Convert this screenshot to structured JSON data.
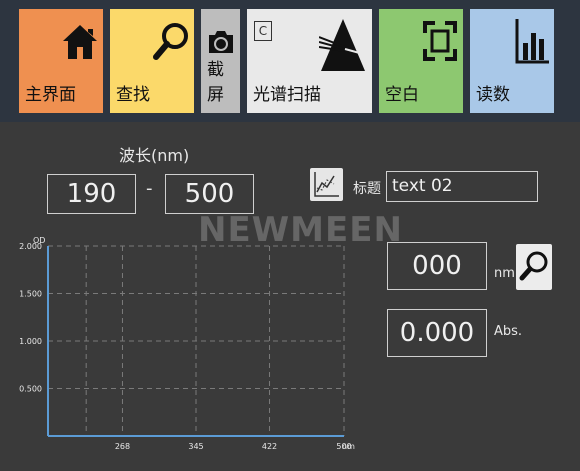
{
  "toolbar": {
    "home": {
      "label": "主界面",
      "icon": "home-icon",
      "color": "#ef9050"
    },
    "find": {
      "label": "查找",
      "icon": "magnifier-icon",
      "color": "#fbd96a"
    },
    "screenshot": {
      "label": "截屏",
      "icon": "camera-icon",
      "color": "#bdbdbd"
    },
    "scan": {
      "label": "光谱扫描",
      "icon": "prism-icon",
      "badge": "C",
      "color": "#e9e9e9"
    },
    "blank": {
      "label": "空白",
      "icon": "frame-icon",
      "color": "#8dc870"
    },
    "read": {
      "label": "读数",
      "icon": "bar-chart-icon",
      "color": "#a9c8e8"
    }
  },
  "wavelength": {
    "title": "波长(nm)",
    "from": "190",
    "separator": "-",
    "to": "500"
  },
  "title_field": {
    "label": "标题",
    "value": "text 02"
  },
  "watermark": "NEWMEEN",
  "reading": {
    "wavelength_value": "000",
    "wavelength_unit": "nm",
    "abs_value": "0.000",
    "abs_unit": "Abs."
  },
  "chart_data": {
    "type": "line",
    "ylabel": "OD",
    "xlabel": "nm",
    "xlim": [
      190,
      500
    ],
    "ylim": [
      0,
      2.0
    ],
    "x_ticks": [
      "268",
      "345",
      "422",
      "500"
    ],
    "y_ticks": [
      "0.500",
      "1.000",
      "1.500",
      "2.000"
    ],
    "series": [],
    "grid": true
  }
}
